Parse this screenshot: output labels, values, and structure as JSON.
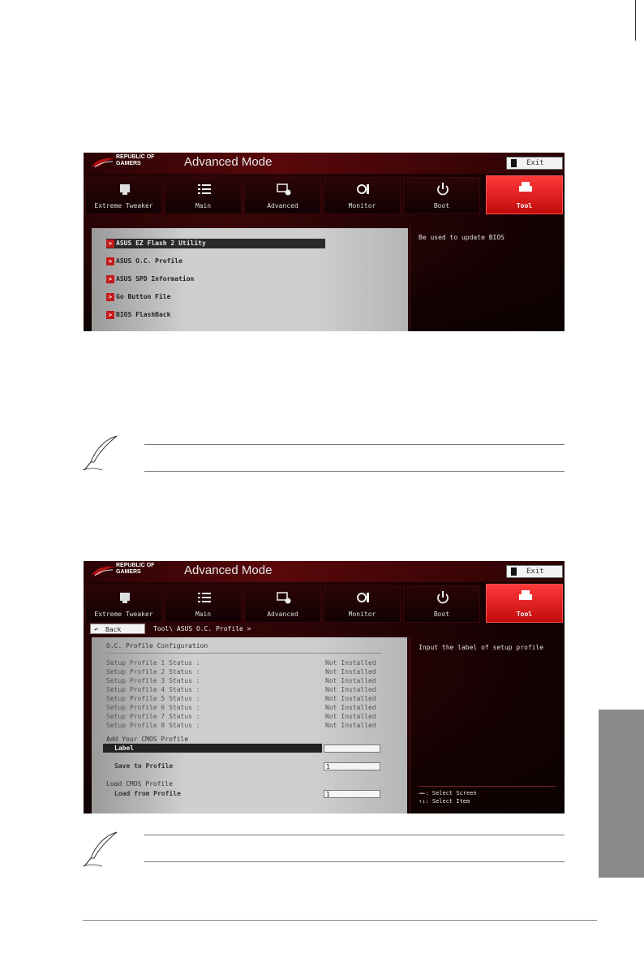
{
  "brand": {
    "line1": "REPUBLIC OF",
    "line2": "GAMERS"
  },
  "mode_title": "Advanced Mode",
  "exit_label": "Exit",
  "tabs": [
    {
      "label": "Extreme Tweaker",
      "icon": "monitor-chip-icon"
    },
    {
      "label": "Main",
      "icon": "list-icon"
    },
    {
      "label": "Advanced",
      "icon": "advanced-settings-icon"
    },
    {
      "label": "Monitor",
      "icon": "fan-icon"
    },
    {
      "label": "Boot",
      "icon": "power-icon"
    },
    {
      "label": "Tool",
      "icon": "printer-tool-icon"
    }
  ],
  "screen1": {
    "menu": [
      {
        "label": "ASUS EZ Flash 2 Utility"
      },
      {
        "label": "ASUS O.C. Profile"
      },
      {
        "label": "ASUS SPD Information"
      },
      {
        "label": "Go Button File"
      },
      {
        "label": "BIOS FlashBack"
      }
    ],
    "help": "Be used to update BIOS"
  },
  "screen2": {
    "back": "Back",
    "breadcrumb": "Tool\\ ASUS O.C. Profile >",
    "config_title": "O.C. Profile Configuration",
    "profiles": [
      {
        "label": "Setup Profile 1 Status :",
        "value": "Not Installed"
      },
      {
        "label": "Setup Profile 2 Status :",
        "value": "Not Installed"
      },
      {
        "label": "Setup Profile 3 Status :",
        "value": "Not Installed"
      },
      {
        "label": "Setup Profile 4 Status :",
        "value": "Not Installed"
      },
      {
        "label": "Setup Profile 5 Status :",
        "value": "Not Installed"
      },
      {
        "label": "Setup Profile 6 Status :",
        "value": "Not Installed"
      },
      {
        "label": "Setup Profile 7 Status :",
        "value": "Not Installed"
      },
      {
        "label": "Setup Profile 8 Status :",
        "value": "Not Installed"
      }
    ],
    "add_title": "Add Your CMOS Profile",
    "label_field": "Label",
    "save_label": "Save to Profile",
    "save_value": "1",
    "load_title": "Load CMOS Profile",
    "load_label": "Load from Profile",
    "load_value": "1",
    "help": "Input the label of setup profile",
    "keys": [
      "→←: Select Screen",
      "↑↓: Select Item"
    ]
  }
}
